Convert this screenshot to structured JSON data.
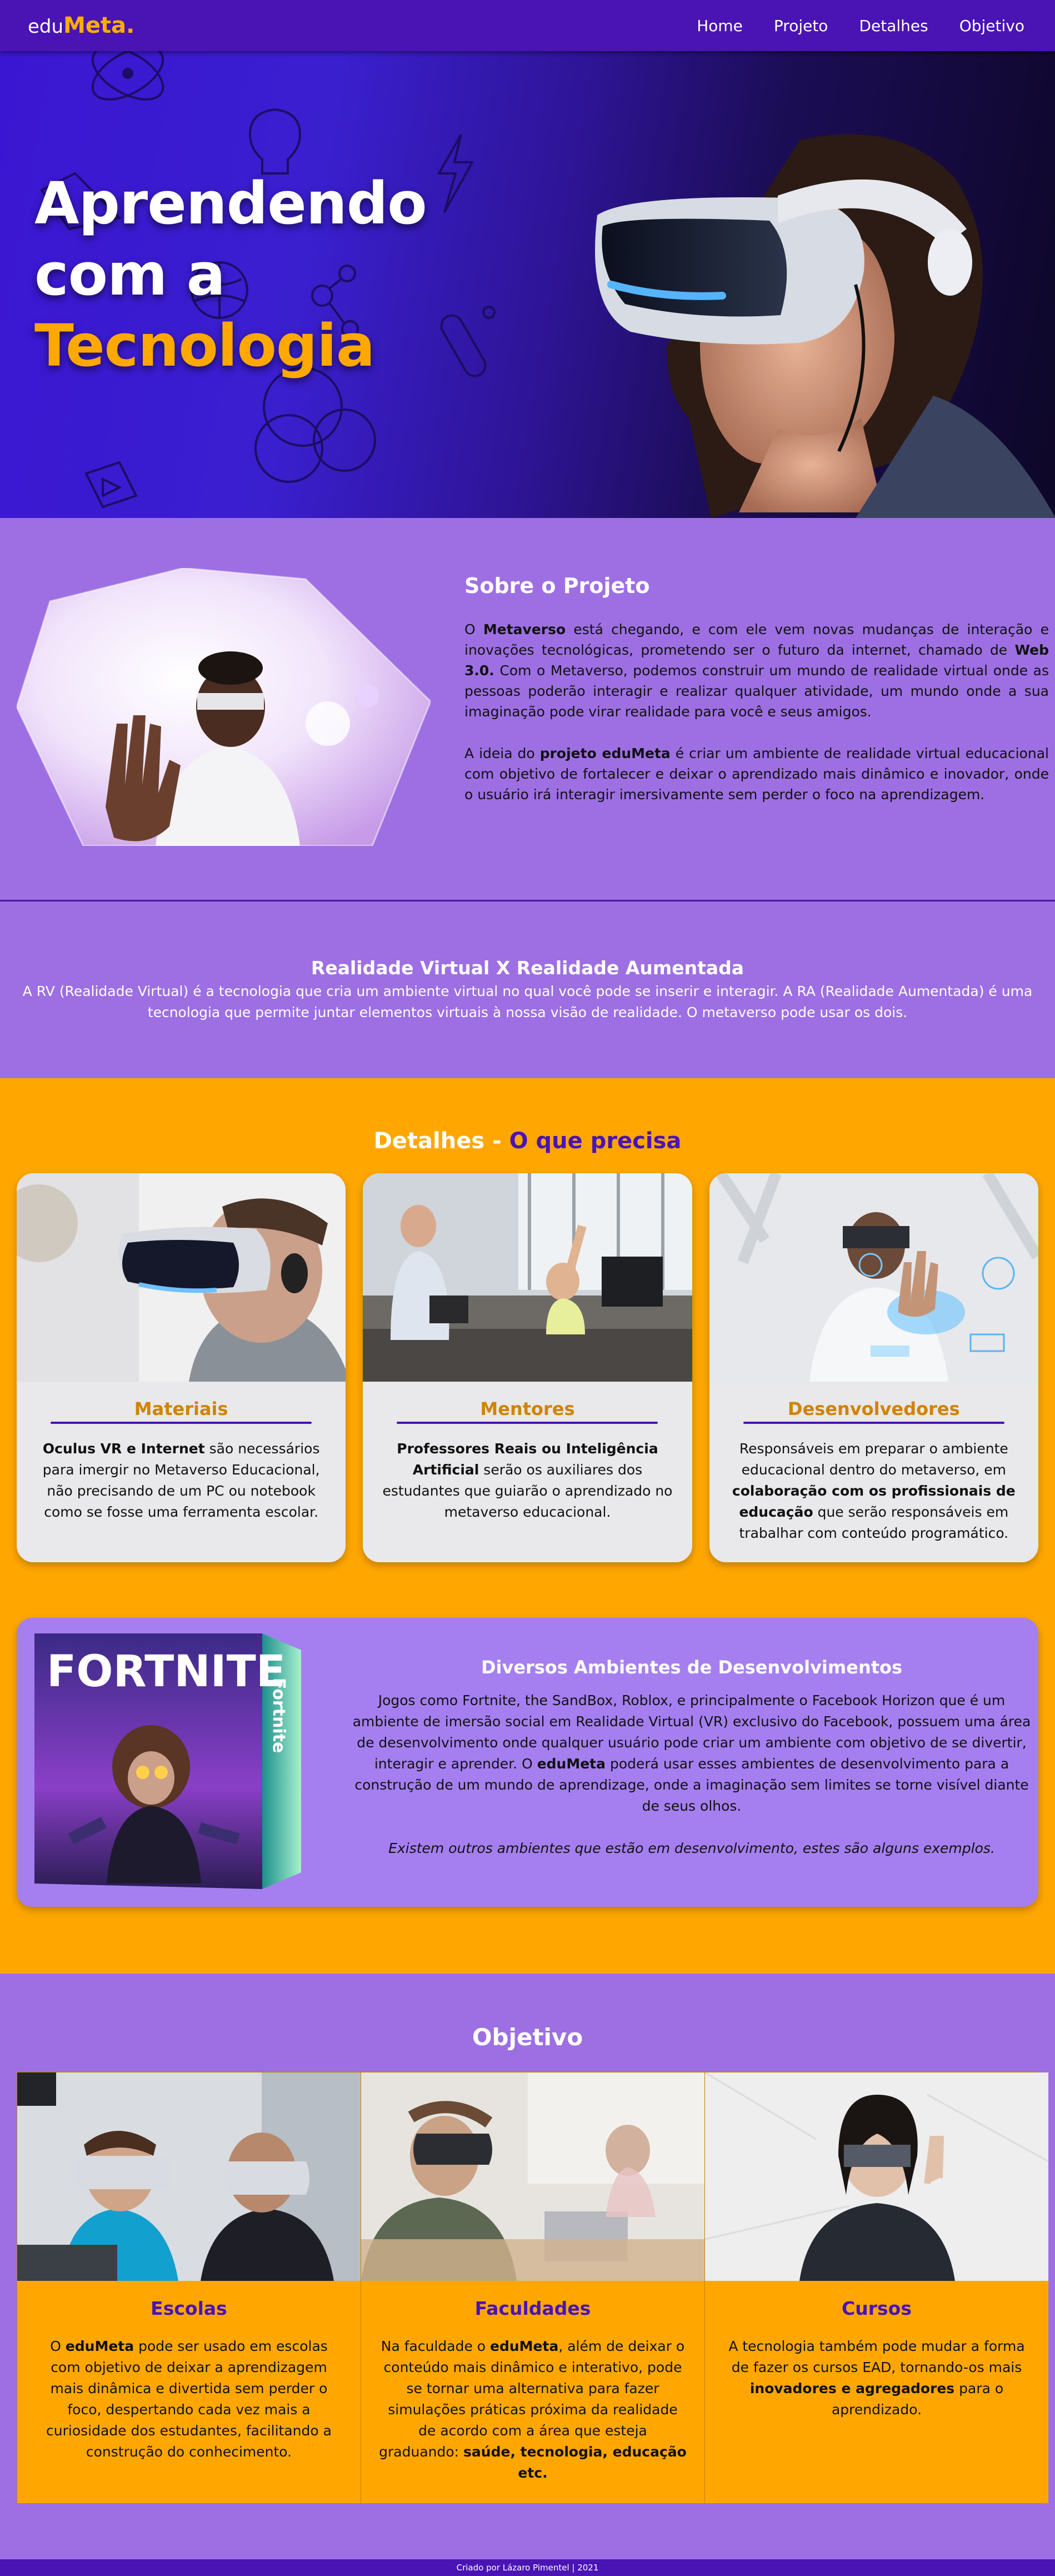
{
  "nav": {
    "logo_prefix": "edu",
    "logo_accent": "Meta.",
    "items": [
      {
        "label": "Home"
      },
      {
        "label": "Projeto"
      },
      {
        "label": "Detalhes"
      },
      {
        "label": "Objetivo"
      }
    ]
  },
  "hero": {
    "line1": "Aprendendo",
    "line2": "com a",
    "line3": "Tecnologia",
    "slides": 1,
    "active_slide": 1,
    "colors": {
      "bg": "#3a1fcf",
      "accent": "#ffa800"
    }
  },
  "sobre": {
    "title": "Sobre o Projeto",
    "p1_a": "O ",
    "p1_b": "Metaverso",
    "p1_c": " está chegando, e com ele vem novas mudanças de interação e inovações tecnológicas, prometendo ser o futuro da internet, chamado de ",
    "p1_d": "Web 3.0.",
    "p1_e": " Com o Metaverso, podemos construir um mundo de realidade virtual onde as pessoas poderão interagir e realizar qualquer atividade, um mundo onde a sua imaginação pode virar realidade para você e seus amigos.",
    "p2_a": "A ideia do ",
    "p2_b": "projeto eduMeta",
    "p2_c": " é criar um ambiente de realidade virtual educacional com objetivo de fortalecer e deixar o aprendizado mais dinâmico e inovador, onde o usuário irá interagir imersivamente sem perder o foco na aprendizagem."
  },
  "rvra": {
    "title": "Realidade Virtual X Realidade Aumentada",
    "text": "A RV (Realidade Virtual) é a tecnologia que cria um ambiente virtual no qual você pode se inserir e interagir. A RA (Realidade Aumentada) é uma tecnologia que permite juntar elementos virtuais à nossa visão de realidade. O metaverso pode usar os dois."
  },
  "detalhes": {
    "title": "Detalhes - ",
    "title_accent": "O que precisa",
    "cards": [
      {
        "title": "Materiais",
        "bold": "Oculus VR e Internet",
        "text": " são necessários para imergir no Metaverso Educacional, não precisando de um PC ou notebook como se fosse uma ferramenta escolar."
      },
      {
        "title": "Mentores",
        "bold": "Professores Reais ou Inteligência Artificial",
        "text": " serão os auxiliares dos estudantes que guiarão o aprendizado no metaverso educacional."
      },
      {
        "title": "Desenvolvedores",
        "text_a": "Responsáveis em preparar o ambiente educacional dentro do metaverso, em ",
        "bold": "colaboração com os profissionais de educação",
        "text_b": " que serão responsáveis em trabalhar com conteúdo programático."
      }
    ]
  },
  "ambientes": {
    "box_logo": "FORTNITE",
    "box_side": "Fortnite",
    "title": "Diversos Ambientes de Desenvolvimentos",
    "p_a": "Jogos como Fortnite, the SandBox, Roblox, e principalmente o Facebook Horizon que é um ambiente de imersão social em Realidade Virtual (VR) exclusivo do Facebook, possuem uma área de desenvolvimento onde qualquer usuário pode criar um ambiente com objetivo de se divertir, interagir e aprender. O ",
    "p_b": "eduMeta",
    "p_c": " poderá usar esses ambientes de desenvolvimento para a construção de um mundo de aprendizage, onde a imaginação sem limites se torne visível diante de seus olhos.",
    "note": "Existem outros ambientes que estão em desenvolvimento, estes são alguns exemplos."
  },
  "objetivo": {
    "title": "Objetivo",
    "cols": [
      {
        "title": "Escolas",
        "a": "O ",
        "b": "eduMeta",
        "c": " pode ser usado em escolas com objetivo de deixar a aprendizagem mais dinâmica e divertida sem perder o foco, despertando cada vez mais a curiosidade dos estudantes, facilitando a construção do conhecimento.",
        "d": "",
        "e": ""
      },
      {
        "title": "Faculdades",
        "a": "Na faculdade o ",
        "b": "eduMeta",
        "c": ", além de deixar o conteúdo mais dinâmico e interativo, pode se tornar uma alternativa para fazer simulações práticas próxima da realidade de acordo com a área que esteja graduando: ",
        "d": "saúde, tecnologia, educação etc.",
        "e": ""
      },
      {
        "title": "Cursos",
        "a": "A tecnologia também pode mudar a forma de fazer os cursos EAD, tornando-os mais ",
        "b": "inovadores e agregadores",
        "c": " para o aprendizado.",
        "d": "",
        "e": ""
      }
    ]
  },
  "footer": {
    "text": "Criado por Lázaro Pimentel | 2021"
  },
  "colors": {
    "purple_dark": "#4a14b4",
    "purple": "#9d6fe3",
    "orange": "#ffa700",
    "card_bg": "#e9e8ea"
  }
}
